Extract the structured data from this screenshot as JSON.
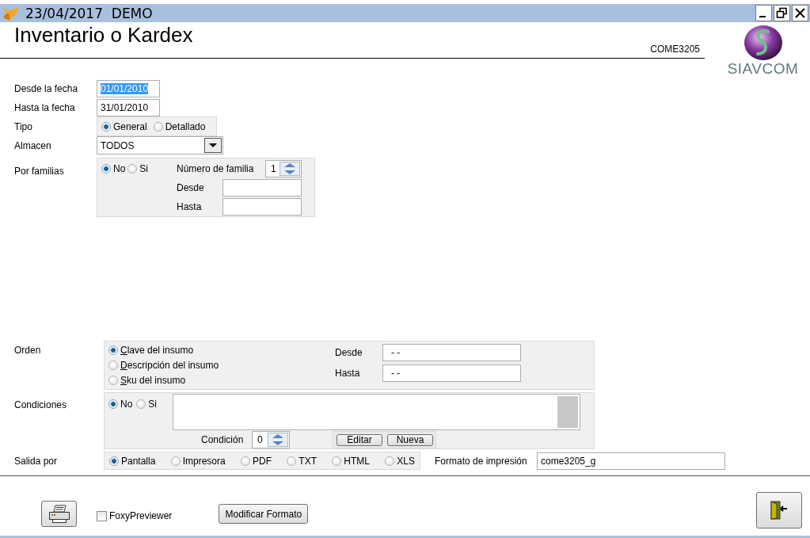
{
  "window": {
    "title": "23/04/2017  DEMO"
  },
  "header": {
    "title": "Inventario o Kardex",
    "code": "COME3205",
    "logo_text": "SIAVCOM"
  },
  "date_from": {
    "label": "Desde la fecha",
    "value": "01/01/2010",
    "selected": true
  },
  "date_to": {
    "label": "Hasta la fecha",
    "value": "31/01/2010",
    "selected": false
  },
  "tipo": {
    "label": "Tipo",
    "options": [
      {
        "label": "General",
        "selected": true
      },
      {
        "label": "Detallado",
        "selected": false
      }
    ]
  },
  "almacen": {
    "label": "Almacen",
    "value": "TODOS"
  },
  "familias": {
    "label": "Por familias",
    "options": [
      {
        "label": "No",
        "selected": true
      },
      {
        "label": "Si",
        "selected": false
      }
    ],
    "number_label": "Número de familia",
    "number_value": "1",
    "from_label": "Desde",
    "to_label": "Hasta"
  },
  "orden": {
    "label": "Orden",
    "options": [
      {
        "label": "Clave del insumo",
        "selected": true
      },
      {
        "label": "Descripción del insumo",
        "selected": false
      },
      {
        "label": "Sku del insumo",
        "selected": false
      }
    ],
    "from_label": "Desde",
    "from_value": "- -",
    "to_label": "Hasta",
    "to_value": "- -"
  },
  "condiciones": {
    "label": "Condiciones",
    "options": [
      {
        "label": "No",
        "selected": true
      },
      {
        "label": "Si",
        "selected": false
      }
    ],
    "condition_label": "Condición",
    "condition_value": "0",
    "buttons": [
      "Editar",
      "Nueva"
    ]
  },
  "salida": {
    "label": "Salida por",
    "options": [
      {
        "label": "Pantalla",
        "selected": true
      },
      {
        "label": "Impresora",
        "selected": false
      },
      {
        "label": "PDF",
        "selected": false
      },
      {
        "label": "TXT",
        "selected": false
      },
      {
        "label": "HTML",
        "selected": false
      },
      {
        "label": "XLS",
        "selected": false
      }
    ],
    "format_label": "Formato de impresión",
    "format_value": "come3205_g"
  },
  "footer": {
    "preview": {
      "label": "FoxyPreviewer",
      "checked": false
    },
    "modify_button": "Modificar Formato"
  }
}
